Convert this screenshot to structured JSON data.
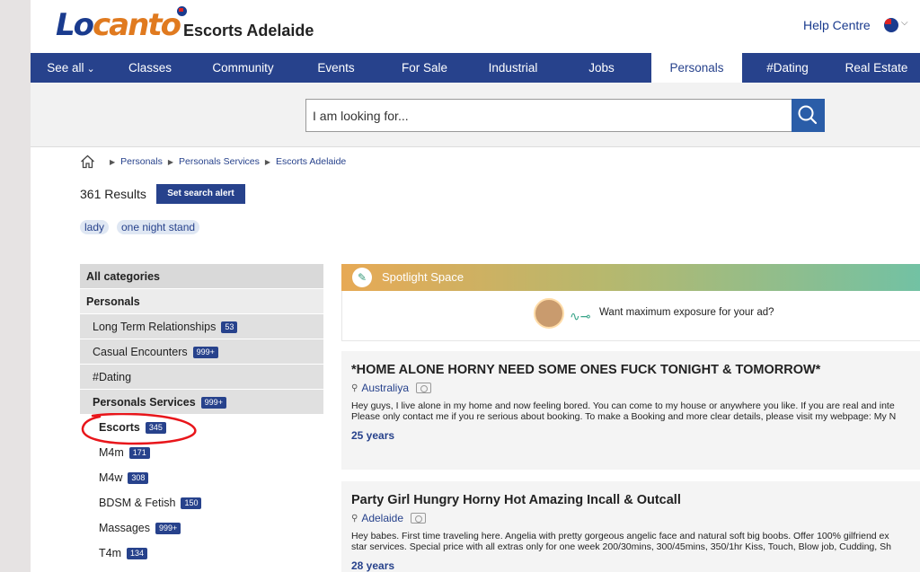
{
  "header": {
    "logo_part1": "Lo",
    "logo_part2": "canto",
    "site_title": "Escorts Adelaide",
    "help": "Help Centre"
  },
  "nav": [
    {
      "label": "See all",
      "name": "nav-see-all",
      "width": 90
    },
    {
      "label": "Classes",
      "name": "nav-classes",
      "width": 86
    },
    {
      "label": "Community",
      "name": "nav-community",
      "width": 121
    },
    {
      "label": "Events",
      "name": "nav-events",
      "width": 86
    },
    {
      "label": "For Sale",
      "name": "nav-for-sale",
      "width": 111
    },
    {
      "label": "Industrial",
      "name": "nav-industrial",
      "width": 86
    },
    {
      "label": "Jobs",
      "name": "nav-jobs",
      "width": 111
    },
    {
      "label": "Personals",
      "name": "nav-personals",
      "width": 101,
      "active": true
    },
    {
      "label": "#Dating",
      "name": "nav-dating",
      "width": 101
    },
    {
      "label": "Real Estate",
      "name": "nav-real-estate",
      "width": 97
    }
  ],
  "search": {
    "placeholder": "I am looking for..."
  },
  "breadcrumb": [
    "Personals",
    "Personals Services",
    "Escorts Adelaide"
  ],
  "results": {
    "count_text": "361 Results",
    "alert_button": "Set search alert"
  },
  "chips": [
    "lady",
    "one night stand"
  ],
  "sidebar": {
    "all": "All categories",
    "personals": "Personals",
    "items": [
      {
        "label": "Long Term Relationships",
        "count": "53"
      },
      {
        "label": "Casual Encounters",
        "count": "999+"
      },
      {
        "label": "#Dating",
        "count": ""
      },
      {
        "label": "Personals Services",
        "count": "999+"
      }
    ],
    "sub_items": [
      {
        "label": "Escorts",
        "count": "345"
      },
      {
        "label": "M4m",
        "count": "171"
      },
      {
        "label": "M4w",
        "count": "308"
      },
      {
        "label": "BDSM & Fetish",
        "count": "150"
      },
      {
        "label": "Massages",
        "count": "999+"
      },
      {
        "label": "T4m",
        "count": "134"
      }
    ]
  },
  "spotlight": {
    "title": "Spotlight Space",
    "text": "Want maximum exposure for your ad?"
  },
  "listings": [
    {
      "title": "*HOME ALONE HORNY NEED SOME ONES FUCK TONIGHT & TOMORROW*",
      "location": "Australiya",
      "desc1": "Hey guys, I live alone in my home and now feeling bored. You can come to my house or anywhere you like. If you are real and inte",
      "desc2": "Please only contact me if you re serious about booking. To make a Booking and more clear details, please visit my webpage: My N",
      "age": "25 years"
    },
    {
      "title": "Party Girl Hungry Horny Hot Amazing Incall & Outcall",
      "location": "Adelaide",
      "desc1": "Hey babes. First time traveling here. Angelia with pretty gorgeous angelic face and natural soft big boobs. Offer 100% gilfriend ex",
      "desc2": "star services. Special price with all extras only for one week 200/30mins, 300/45mins, 350/1hr Kiss, Touch, Blow job, Cudding, Sh",
      "age": "28 years"
    }
  ],
  "colors": {
    "brand_blue": "#27428c",
    "brand_orange": "#e07a1f",
    "annotation_red": "#e8161b"
  }
}
